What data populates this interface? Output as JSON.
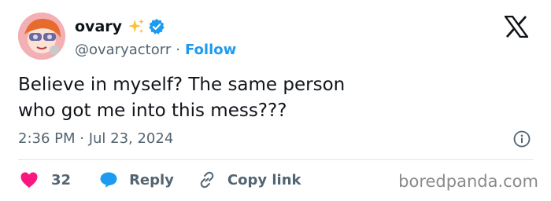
{
  "profile": {
    "display_name": "ovary",
    "handle": "@ovaryactorr",
    "separator": "·",
    "follow_label": "Follow"
  },
  "tweet": {
    "text_lines": [
      "Believe in myself? The same person",
      "who got me into this mess???"
    ],
    "timestamp": "2:36 PM · Jul 23, 2024"
  },
  "actions": {
    "like_count": "32",
    "reply_label": "Reply",
    "copy_link_label": "Copy link"
  },
  "watermark": "boredpanda.com",
  "icons": {
    "sparkle": "sparkles-emoji-icon",
    "verified": "verified-badge-icon",
    "platform": "x-logo-icon",
    "info": "info-icon",
    "like": "heart-icon",
    "reply": "speech-bubble-icon",
    "copy": "link-icon"
  },
  "colors": {
    "link_blue": "#1d9bf0",
    "like_pink": "#f91880",
    "muted_text": "#536471",
    "text": "#0f1419",
    "sparkle_yellow": "#f7c23a"
  }
}
